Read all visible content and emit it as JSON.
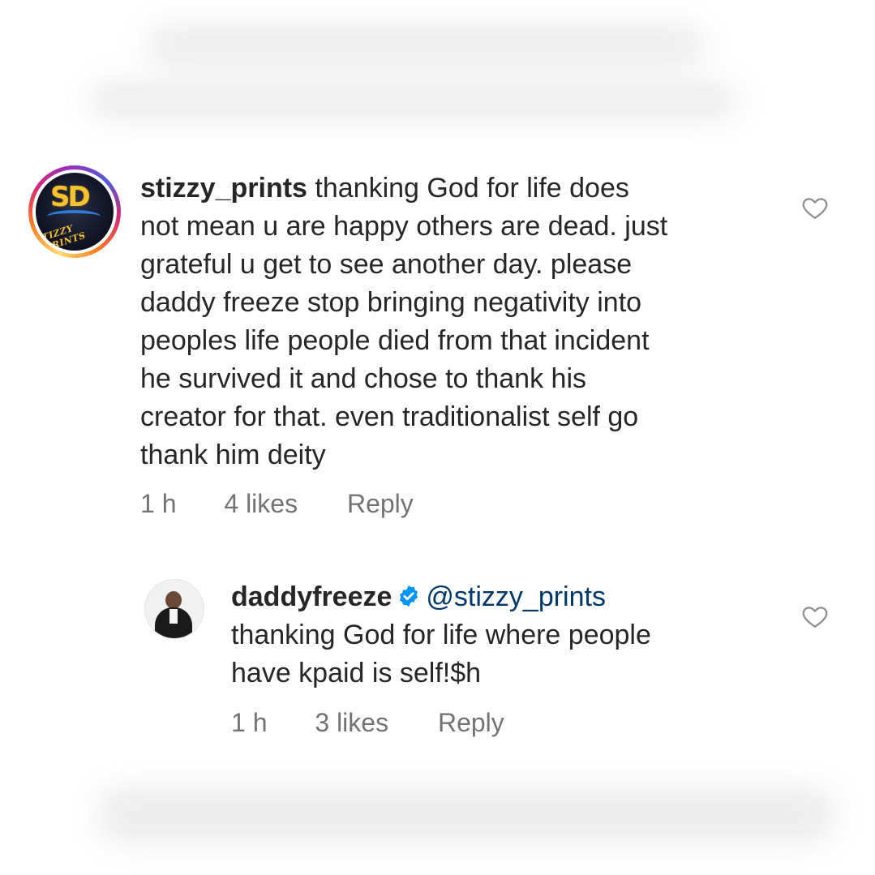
{
  "comments": [
    {
      "username": "stizzy_prints",
      "avatar": {
        "logo_letters": "SD",
        "logo_text": "TIZZY PRINTS"
      },
      "text_lines": [
        "thanking God for life does",
        "not mean u are happy others are dead. just",
        "grateful u get to see another day. please",
        "daddy freeze stop bringing negativity into",
        "peoples life people died from that incident",
        "he survived it and chose to thank his",
        "creator for that. even traditionalist self go",
        "thank him deity"
      ],
      "time": "1 h",
      "likes": "4 likes",
      "reply_label": "Reply",
      "like_icon": "heart-outline-icon"
    },
    {
      "username": "daddyfreeze",
      "verified": true,
      "mention": "@stizzy_prints",
      "text_lines": [
        "thanking God for life where people",
        "have kpaid is self!$h"
      ],
      "time": "1 h",
      "likes": "3 likes",
      "reply_label": "Reply",
      "like_icon": "heart-outline-icon"
    }
  ],
  "colors": {
    "text": "#262626",
    "secondary": "#737373",
    "mention": "#00376b",
    "verified_badge": "#0095f6"
  }
}
